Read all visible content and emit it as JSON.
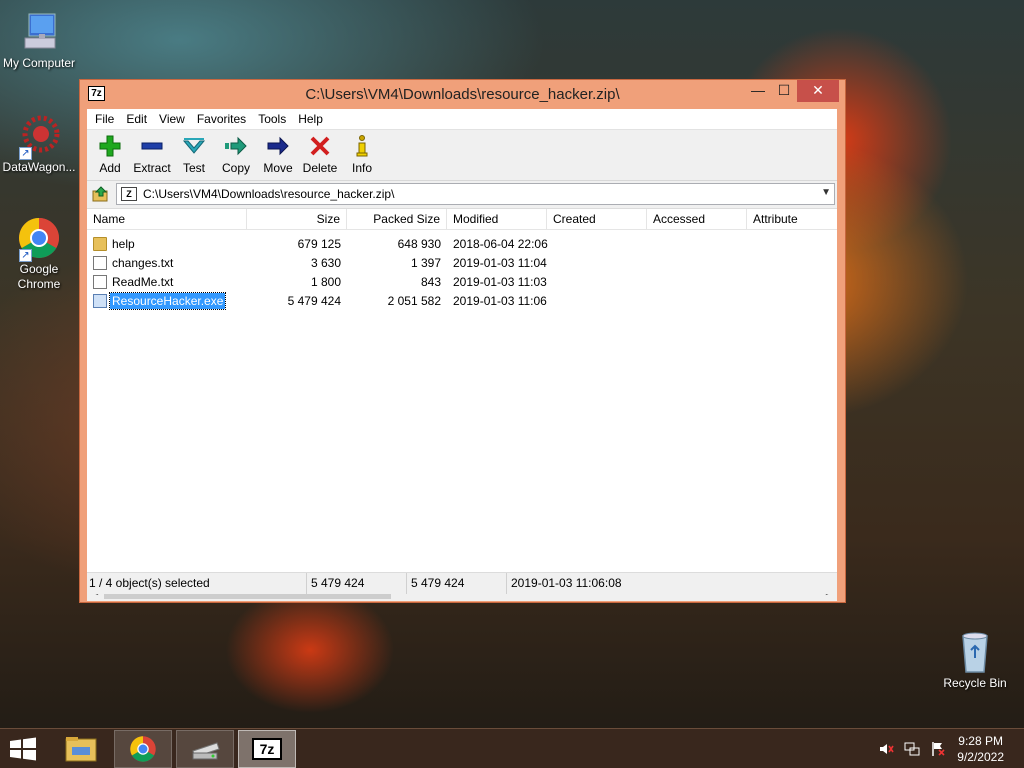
{
  "desktop": {
    "icons": [
      {
        "label": "My Computer",
        "icon": "computer-icon"
      },
      {
        "label": "DataWagon...",
        "icon": "datawagon-icon"
      },
      {
        "label": "Google Chrome",
        "icon": "chrome-icon"
      },
      {
        "label": "Recycle Bin",
        "icon": "recycle-bin-icon"
      }
    ]
  },
  "window": {
    "title": "C:\\Users\\VM4\\Downloads\\resource_hacker.zip\\",
    "app_icon_text": "7z",
    "controls": {
      "minimize": "—",
      "maximize": "☐",
      "close": "✕"
    },
    "menu": [
      "File",
      "Edit",
      "View",
      "Favorites",
      "Tools",
      "Help"
    ],
    "toolbar": [
      {
        "label": "Add",
        "icon": "add-icon",
        "color": "#1fa81f"
      },
      {
        "label": "Extract",
        "icon": "extract-icon",
        "color": "#1f3fa8"
      },
      {
        "label": "Test",
        "icon": "test-icon",
        "color": "#2aa7b8"
      },
      {
        "label": "Copy",
        "icon": "copy-icon",
        "color": "#1f9a7a"
      },
      {
        "label": "Move",
        "icon": "move-icon",
        "color": "#1a2a8c"
      },
      {
        "label": "Delete",
        "icon": "delete-icon",
        "color": "#d21f1f"
      },
      {
        "label": "Info",
        "icon": "info-icon",
        "color": "#c9a500"
      }
    ],
    "address": {
      "value": "C:\\Users\\VM4\\Downloads\\resource_hacker.zip\\",
      "icon_text": "Z"
    },
    "columns": [
      "Name",
      "Size",
      "Packed Size",
      "Modified",
      "Created",
      "Accessed",
      "Attribute"
    ],
    "rows": [
      {
        "name": "help",
        "type": "folder",
        "size": "679 125",
        "packed": "648 930",
        "modified": "2018-06-04 22:06",
        "created": "",
        "accessed": "",
        "attr": "",
        "selected": false
      },
      {
        "name": "changes.txt",
        "type": "file",
        "size": "3 630",
        "packed": "1 397",
        "modified": "2019-01-03 11:04",
        "created": "",
        "accessed": "",
        "attr": "",
        "selected": false
      },
      {
        "name": "ReadMe.txt",
        "type": "file",
        "size": "1 800",
        "packed": "843",
        "modified": "2019-01-03 11:03",
        "created": "",
        "accessed": "",
        "attr": "",
        "selected": false
      },
      {
        "name": "ResourceHacker.exe",
        "type": "exe",
        "size": "5 479 424",
        "packed": "2 051 582",
        "modified": "2019-01-03 11:06",
        "created": "",
        "accessed": "",
        "attr": "",
        "selected": true
      }
    ],
    "status": {
      "selection": "1 / 4 object(s) selected",
      "size": "5 479 424",
      "packed": "5 479 424",
      "modified": "2019-01-03 11:06:08"
    },
    "scroll": {
      "left_arrow": "<",
      "right_arrow": ">"
    }
  },
  "taskbar": {
    "apps": [
      "file-explorer-icon",
      "chrome-icon",
      "drive-icon",
      "7zip-icon"
    ],
    "sevenzip_text": "7z",
    "time": "9:28 PM",
    "date": "9/2/2022"
  }
}
